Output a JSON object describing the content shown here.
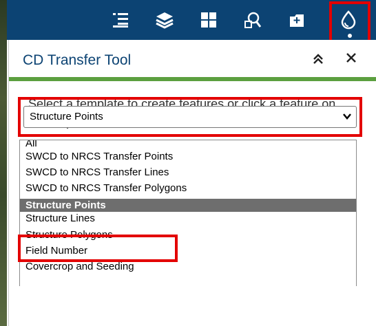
{
  "toolbar": {
    "icons": [
      "list-icon",
      "layers-icon",
      "grid-icon",
      "query-icon",
      "add-data-icon",
      "edit-drop-icon"
    ],
    "active": "edit-drop-icon"
  },
  "panel": {
    "title": "CD Transfer Tool",
    "collapse_label": "︽",
    "close_label": "✕",
    "instructions": "Select a template to create features or click a feature on the map to edit it"
  },
  "template_select": {
    "value": "Structure Points",
    "options": [
      "All",
      "SWCD to NRCS Transfer Points",
      "SWCD to NRCS Transfer Lines",
      "SWCD to NRCS Transfer Polygons",
      "Structure Points",
      "Structure Lines",
      "Structure Polygons",
      "Field Number",
      "Covercrop and Seeding"
    ],
    "selected_index": 4
  },
  "colors": {
    "toolbar_bg": "#0c4373",
    "title": "#0c4373",
    "header_accent": "#5c9f3f",
    "highlight": "#e30000",
    "selected_option_bg": "#6e6e6e"
  }
}
